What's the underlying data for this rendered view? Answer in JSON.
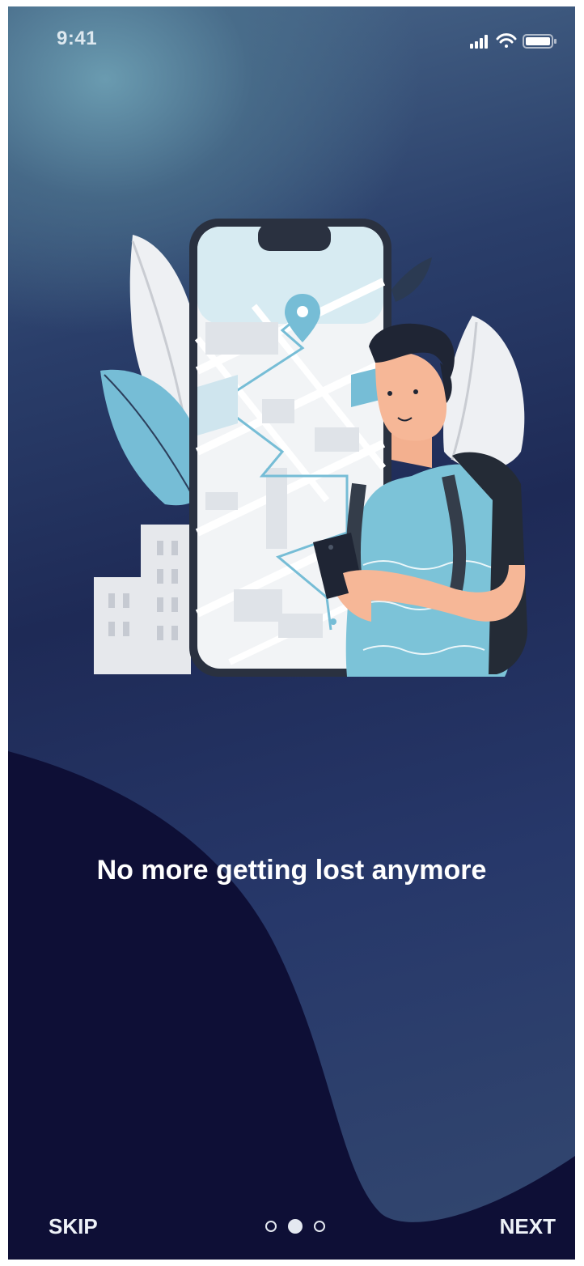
{
  "status_bar": {
    "time": "9:41",
    "icons": [
      "signal-icon",
      "wifi-icon",
      "battery-icon"
    ]
  },
  "onboarding": {
    "headline": "No more getting lost anymore",
    "illustration": "person-with-phone-map-illustration",
    "pagination": {
      "total": 3,
      "active_index": 1
    }
  },
  "actions": {
    "skip_label": "SKIP",
    "next_label": "NEXT"
  },
  "colors": {
    "wave": "#0e0f36",
    "accent": "#76bdd6",
    "text": "#ffffff"
  }
}
